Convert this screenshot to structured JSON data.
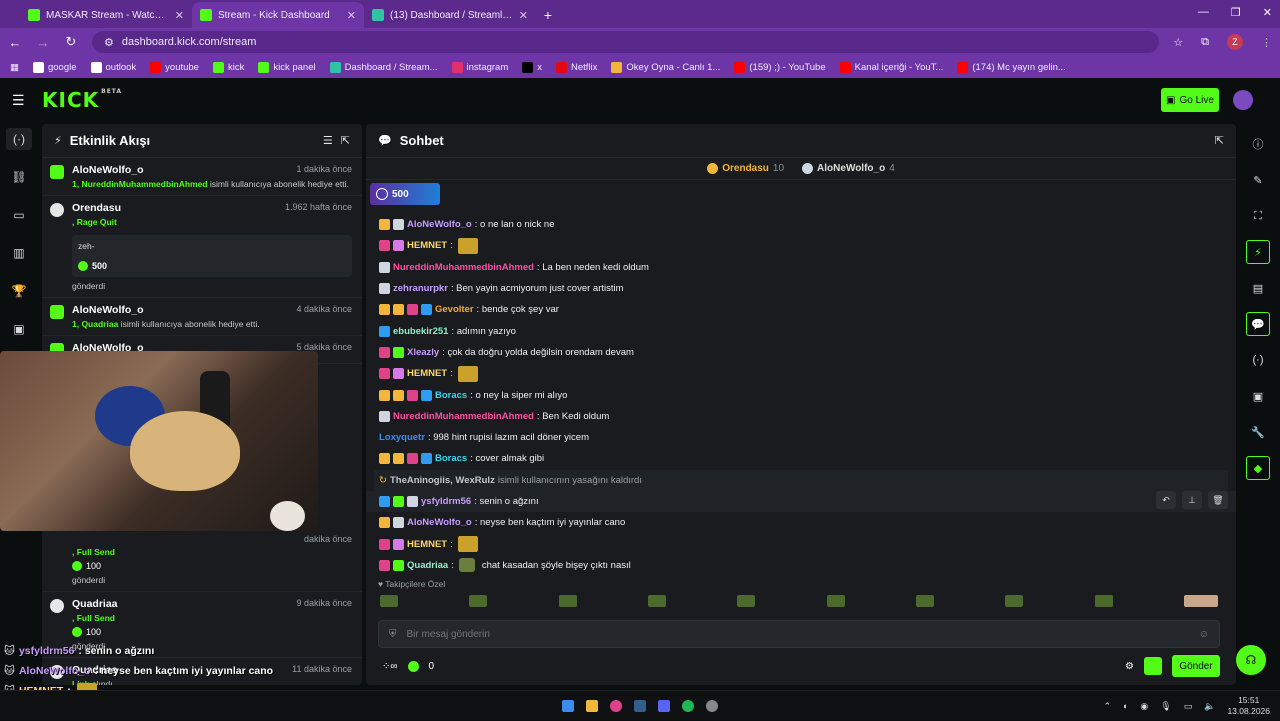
{
  "browser": {
    "tabs": [
      {
        "title": "MASKAR Stream - Watch Live o",
        "color": "#53fc18",
        "active": false
      },
      {
        "title": "Stream - Kick Dashboard",
        "color": "#53fc18",
        "active": true
      },
      {
        "title": "(13) Dashboard / Streamlabs",
        "color": "#31c3a2",
        "active": false
      }
    ],
    "url": "dashboard.kick.com/stream",
    "profile_letter": "Z",
    "bookmarks": [
      {
        "label": "google",
        "color": "#ffffff"
      },
      {
        "label": "outlook",
        "color": "#ffffff"
      },
      {
        "label": "youtube",
        "color": "#ff0000"
      },
      {
        "label": "kick",
        "color": "#53fc18"
      },
      {
        "label": "kick panel",
        "color": "#53fc18"
      },
      {
        "label": "Dashboard / Stream...",
        "color": "#31c3a2"
      },
      {
        "label": "instagram",
        "color": "#e1306c"
      },
      {
        "label": "x",
        "color": "#000000"
      },
      {
        "label": "Netflix",
        "color": "#e50914"
      },
      {
        "label": "Okey Oyna - Canlı 1...",
        "color": "#f2b63a"
      },
      {
        "label": "(159) ;) - YouTube",
        "color": "#ff0000"
      },
      {
        "label": "Kanal içeriği - YouT...",
        "color": "#ff0000"
      },
      {
        "label": "(174) Mc yayın gelin...",
        "color": "#ff0000"
      }
    ]
  },
  "kick": {
    "logo": "KICK",
    "logo_badge": "BETA",
    "go_live": "Go Live"
  },
  "activity": {
    "title": "Etkinlik Akışı",
    "items": [
      {
        "user": "AloNeWolfo_o",
        "time": "1 dakika önce",
        "detail_highlight": "1, NureddinMuhammedbinAhmed",
        "detail": " isimli kullanıcıya abonelik hediye etti."
      },
      {
        "user": "Orendasu",
        "time": "1.962 hafta önce",
        "detail_highlight": ", Rage Quit",
        "detail": "",
        "message": "zeh-",
        "points": "500",
        "sent": "gönderdi"
      },
      {
        "user": "AloNeWolfo_o",
        "time": "4 dakika önce",
        "detail_highlight": "1, Quadriaa",
        "detail": " isimli kullanıcıya abonelik hediye etti."
      },
      {
        "user": "AloNeWolfo_o",
        "time": "5 dakika önce",
        "detail_highlight": "",
        "detail": ""
      }
    ],
    "lower": [
      {
        "user": "Quadriaa",
        "time": "9 dakika önce",
        "detail_highlight": ", Full Send",
        "points": "100",
        "sent": "gönderdi"
      },
      {
        "user": "Quadriaa",
        "time": "11 dakika önce",
        "detail_highlight": "Link",
        "detail": " alındı"
      }
    ],
    "partial": {
      "detail_highlight": ", Full Send",
      "points": "100",
      "sent": "gönderdi",
      "time": "dakika önce"
    }
  },
  "chat": {
    "title": "Sohbet",
    "leaderboard": [
      {
        "name": "Orendasu",
        "value": "10"
      },
      {
        "name": "AloNeWolfo_o",
        "value": "4"
      }
    ],
    "pinned_points": "500",
    "messages": [
      {
        "user": "AloNeWolfo_o",
        "color": "#c89cff",
        "text": ": o ne lan o nick ne",
        "badges": [
          "#f2b63a",
          "#cfd6e0"
        ]
      },
      {
        "user": "HEMNET",
        "color": "#ffd866",
        "text": ":",
        "badges": [
          "#e0428a",
          "#d77ae8"
        ],
        "emote": true
      },
      {
        "user": "NureddinMuhammedbinAhmed",
        "color": "#ff4fa3",
        "text": ": La ben neden kedi oldum",
        "badges": [
          "#cfd6e0"
        ]
      },
      {
        "user": "zehranurpkr",
        "color": "#c89cff",
        "text": ": Ben yayin acmiyorum just cover artistim",
        "badges": [
          "#cfd6e0"
        ]
      },
      {
        "user": "Gevolter",
        "color": "#ffa63a",
        "text": ": bende çok şey var",
        "badges": [
          "#f2b63a",
          "#f2b63a",
          "#e0428a",
          "#2f9cf0"
        ]
      },
      {
        "user": "ebubekir251",
        "color": "#8ff0c8",
        "text": ": adımın yazıyo",
        "badges": [
          "#2f9cf0"
        ]
      },
      {
        "user": "Xleazly",
        "color": "#c89cff",
        "text": ": çok da doğru yolda değilsin orendam devam",
        "badges": [
          "#e0428a",
          "#53fc18"
        ]
      },
      {
        "user": "HEMNET",
        "color": "#ffd866",
        "text": ":",
        "badges": [
          "#e0428a",
          "#d77ae8"
        ],
        "emote": true
      },
      {
        "user": "Boracs",
        "color": "#3ad6f0",
        "text": ": o ney la siper mi alıyo",
        "badges": [
          "#f2b63a",
          "#f2b63a",
          "#e0428a",
          "#2f9cf0"
        ]
      },
      {
        "user": "NureddinMuhammedbinAhmed",
        "color": "#ff4fa3",
        "text": ": Ben Kedi oldum",
        "badges": [
          "#cfd6e0"
        ]
      },
      {
        "user": "Loxyquetr",
        "color": "#3a8cf0",
        "text": ": 998 hint rupisi lazım acil döner yicem",
        "badges": []
      },
      {
        "user": "Boracs",
        "color": "#3ad6f0",
        "text": ": cover almak gibi",
        "badges": [
          "#f2b63a",
          "#f2b63a",
          "#e0428a",
          "#2f9cf0"
        ]
      }
    ],
    "system": {
      "users": "TheAninogiis, WexRulz",
      "text": " isimli kullanıcının yasağını kaldırdı"
    },
    "messages2": [
      {
        "user": "ysfyldrm56",
        "color": "#c89cff",
        "text": ": senin o ağzını",
        "badges": [
          "#2f9cf0",
          "#53fc18",
          "#cfd6e0"
        ],
        "hover": true
      },
      {
        "user": "AloNeWolfo_o",
        "color": "#c89cff",
        "text": ": neyse ben kaçtım iyi yayınlar cano",
        "badges": [
          "#f2b63a",
          "#cfd6e0"
        ]
      },
      {
        "user": "HEMNET",
        "color": "#ffd866",
        "text": ":",
        "badges": [
          "#e0428a",
          "#d77ae8"
        ],
        "emote": true
      },
      {
        "user": "Quadriaa",
        "color": "#8ff0c8",
        "text": "chat kasadan şöyle bişey çıktı nasıl",
        "badges": [
          "#e0428a",
          "#53fc18"
        ],
        "emote2": true
      }
    ],
    "emote_section": "Takipçilere Özel",
    "input_placeholder": "Bir mesaj gönderin",
    "points_balance": "0",
    "send": "Gönder"
  },
  "overlay": [
    {
      "user": "ysfyldrm56",
      "color": "#c89cff",
      "text": ": senin o ağzını"
    },
    {
      "user": "AloNeWolfo_o",
      "color": "#c89cff",
      "text": ": neyse ben kaçtım iyi yayınlar cano"
    },
    {
      "user": "HEMNET",
      "color": "#ffd866",
      "text": ":"
    },
    {
      "user": "Quadriaa",
      "color": "#8ff0c8",
      "text": "chat kasadan şöyle bişey çıktı nasıl"
    }
  ],
  "taskbar": {
    "time": "15:51",
    "date": "13.08.2026"
  }
}
